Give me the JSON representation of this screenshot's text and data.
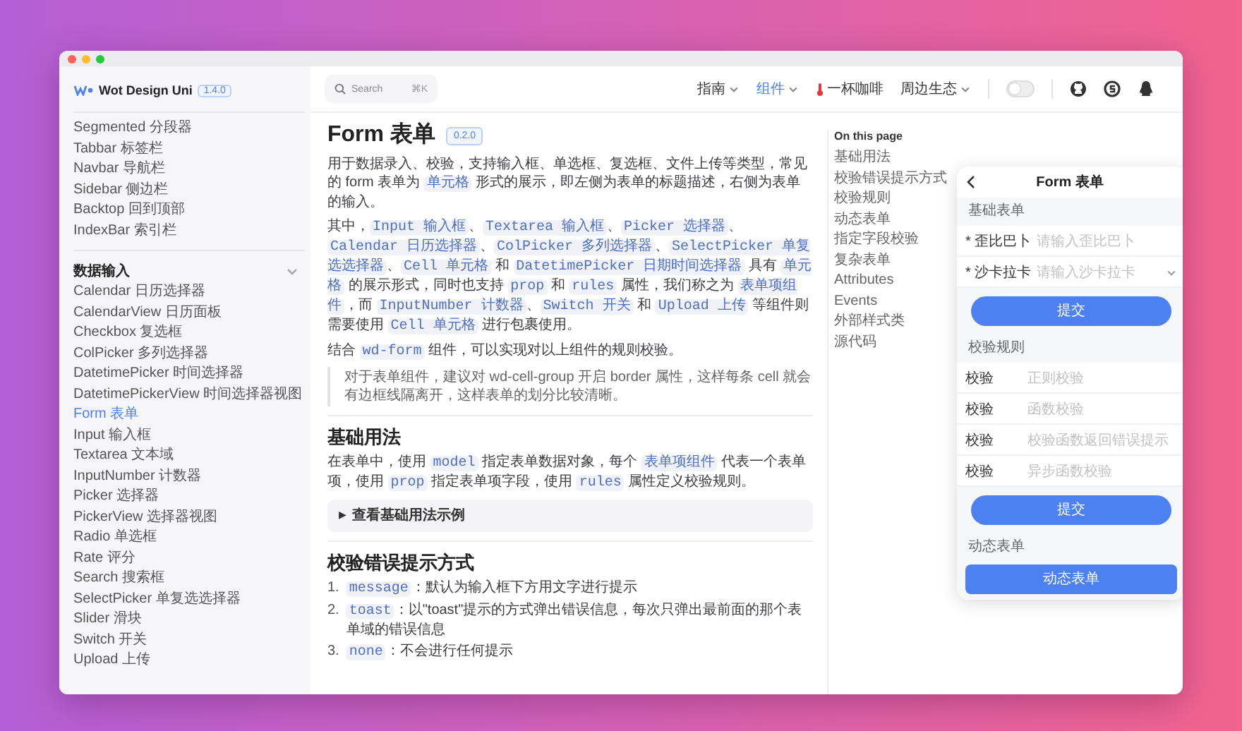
{
  "sidebar": {
    "logo_text": "Wot Design Uni",
    "version": "1.4.0",
    "items": [
      {
        "label": "Segmented 分段器",
        "selected": false
      },
      {
        "label": "Tabbar 标签栏",
        "selected": false
      },
      {
        "label": "Navbar 导航栏",
        "selected": false
      },
      {
        "label": "Sidebar 侧边栏",
        "selected": false
      },
      {
        "label": "Backtop 回到顶部",
        "selected": false
      },
      {
        "label": "IndexBar 索引栏",
        "selected": false
      }
    ],
    "groups": [
      {
        "title": "数据输入",
        "expanded": true,
        "items": [
          {
            "label": "Calendar 日历选择器",
            "selected": false
          },
          {
            "label": "CalendarView 日历面板",
            "selected": false
          },
          {
            "label": "Checkbox 复选框",
            "selected": false
          },
          {
            "label": "ColPicker 多列选择器",
            "selected": false
          },
          {
            "label": "DatetimePicker 时间选择器",
            "selected": false
          },
          {
            "label": "DatetimePickerView 时间选择器视图",
            "selected": false
          },
          {
            "label": "Form 表单",
            "selected": true
          },
          {
            "label": "Input 输入框",
            "selected": false
          },
          {
            "label": "Textarea 文本域",
            "selected": false
          },
          {
            "label": "InputNumber 计数器",
            "selected": false
          },
          {
            "label": "Picker 选择器",
            "selected": false
          },
          {
            "label": "PickerView 选择器视图",
            "selected": false
          },
          {
            "label": "Radio 单选框",
            "selected": false
          },
          {
            "label": "Rate 评分",
            "selected": false
          },
          {
            "label": "Search 搜索框",
            "selected": false
          },
          {
            "label": "SelectPicker 单复选选择器",
            "selected": false
          },
          {
            "label": "Slider 滑块",
            "selected": false
          },
          {
            "label": "Switch 开关",
            "selected": false
          },
          {
            "label": "Upload 上传",
            "selected": false
          }
        ]
      }
    ]
  },
  "topbar": {
    "search": {
      "placeholder": "Search",
      "shortcut": "⌘K"
    },
    "nav": [
      {
        "label": "指南",
        "kind": "menu",
        "selected": false
      },
      {
        "label": "组件",
        "kind": "menu",
        "selected": true
      },
      {
        "label": "一杯咖啡",
        "kind": "link",
        "selected": false
      },
      {
        "label": "周边生态",
        "kind": "menu",
        "selected": false
      }
    ],
    "theme_switch": {
      "on": false
    }
  },
  "article": {
    "title": "Form 表单",
    "badge": "0.2.0",
    "blocks": [
      {
        "kind": "p",
        "parts": [
          {
            "text": "用于数据录入、校验，支持输入框、单选框、复选框、文件上传等类型，常见的 form 表单为 ",
            "code": false
          },
          {
            "text": "单元格",
            "code": true
          },
          {
            "text": " 形式的展示，即左侧为表单的标题描述，右侧为表单的输入。",
            "code": false
          }
        ]
      },
      {
        "kind": "p",
        "parts": [
          {
            "text": "其中，",
            "code": false
          },
          {
            "text": "Input 输入框",
            "code": true
          },
          {
            "text": "、",
            "code": false
          },
          {
            "text": "Textarea 输入框",
            "code": true
          },
          {
            "text": "、",
            "code": false
          },
          {
            "text": "Picker 选择器",
            "code": true
          },
          {
            "text": "、",
            "code": false
          },
          {
            "text": "Calendar 日历选择器",
            "code": true
          },
          {
            "text": "、",
            "code": false
          },
          {
            "text": "ColPicker 多列选择器",
            "code": true
          },
          {
            "text": "、",
            "code": false
          },
          {
            "text": "SelectPicker 单复选选择器",
            "code": true
          },
          {
            "text": "、",
            "code": false
          },
          {
            "text": "Cell 单元格",
            "code": true
          },
          {
            "text": " 和 ",
            "code": false
          },
          {
            "text": "DatetimePicker 日期时间选择器",
            "code": true
          },
          {
            "text": " 具有 ",
            "code": false
          },
          {
            "text": "单元格",
            "code": true
          },
          {
            "text": " 的展示形式，同时也支持 ",
            "code": false
          },
          {
            "text": "prop",
            "code": true
          },
          {
            "text": " 和 ",
            "code": false
          },
          {
            "text": "rules",
            "code": true
          },
          {
            "text": " 属性，我们称之为 ",
            "code": false
          },
          {
            "text": "表单项组件",
            "code": true
          },
          {
            "text": "，而 ",
            "code": false
          },
          {
            "text": "InputNumber 计数器",
            "code": true
          },
          {
            "text": "、",
            "code": false
          },
          {
            "text": "Switch 开关",
            "code": true
          },
          {
            "text": " 和 ",
            "code": false
          },
          {
            "text": "Upload 上传",
            "code": true
          },
          {
            "text": " 等组件则需要使用 ",
            "code": false
          },
          {
            "text": "Cell 单元格",
            "code": true
          },
          {
            "text": " 进行包裹使用。",
            "code": false
          }
        ]
      },
      {
        "kind": "p",
        "parts": [
          {
            "text": "结合 ",
            "code": false
          },
          {
            "text": "wd-form",
            "code": true
          },
          {
            "text": " 组件，可以实现对以上组件的规则校验。",
            "code": false
          }
        ]
      },
      {
        "kind": "quote",
        "text": "对于表单组件，建议对 wd-cell-group 开启 border 属性，这样每条 cell 就会有边框线隔离开，这样表单的划分比较清晰。"
      },
      {
        "kind": "h2",
        "text": "基础用法"
      },
      {
        "kind": "p",
        "parts": [
          {
            "text": "在表单中，使用 ",
            "code": false
          },
          {
            "text": "model",
            "code": true
          },
          {
            "text": " 指定表单数据对象，每个 ",
            "code": false
          },
          {
            "text": "表单项组件",
            "code": true
          },
          {
            "text": " 代表一个表单项，使用 ",
            "code": false
          },
          {
            "text": "prop",
            "code": true
          },
          {
            "text": " 指定表单项字段，使用 ",
            "code": false
          },
          {
            "text": "rules",
            "code": true
          },
          {
            "text": " 属性定义校验规则。",
            "code": false
          }
        ]
      },
      {
        "kind": "details",
        "marker": "▶",
        "summary": "查看基础用法示例",
        "expanded": false
      },
      {
        "kind": "h2",
        "text": "校验错误提示方式"
      },
      {
        "kind": "ol",
        "items": [
          {
            "number": "1.",
            "parts": [
              {
                "text": "message",
                "code": true
              },
              {
                "text": "：默认为输入框下方用文字进行提示",
                "code": false
              }
            ]
          },
          {
            "number": "2.",
            "parts": [
              {
                "text": "toast",
                "code": true
              },
              {
                "text": "：以\"toast\"提示的方式弹出错误信息，每次只弹出最前面的那个表单域的错误信息",
                "code": false
              }
            ]
          },
          {
            "number": "3.",
            "parts": [
              {
                "text": "none",
                "code": true
              },
              {
                "text": "：不会进行任何提示",
                "code": false
              }
            ]
          }
        ]
      }
    ]
  },
  "toc": {
    "title": "On this page",
    "items": [
      "基础用法",
      "校验错误提示方式",
      "校验规则",
      "动态表单",
      "指定字段校验",
      "复杂表单",
      "Attributes",
      "Events",
      "外部样式类",
      "源代码"
    ]
  },
  "phone": {
    "title": "Form 表单",
    "sections": [
      {
        "title": "基础表单",
        "rows": [
          {
            "required_mark": "*",
            "label": "歪比巴卜",
            "placeholder": "请输入歪比巴卜",
            "kind": "input"
          },
          {
            "required_mark": "*",
            "label": "沙卡拉卡",
            "placeholder": "请输入沙卡拉卡",
            "kind": "select"
          }
        ],
        "button": "提交"
      },
      {
        "title": "校验规则",
        "rows": [
          {
            "label": "校验",
            "placeholder": "正则校验",
            "kind": "input"
          },
          {
            "label": "校验",
            "placeholder": "函数校验",
            "kind": "input"
          },
          {
            "label": "校验",
            "placeholder": "校验函数返回错误提示",
            "kind": "input"
          },
          {
            "label": "校验",
            "placeholder": "异步函数校验",
            "kind": "input"
          }
        ],
        "button": "提交"
      },
      {
        "title": "动态表单",
        "button": "动态表单"
      }
    ]
  }
}
